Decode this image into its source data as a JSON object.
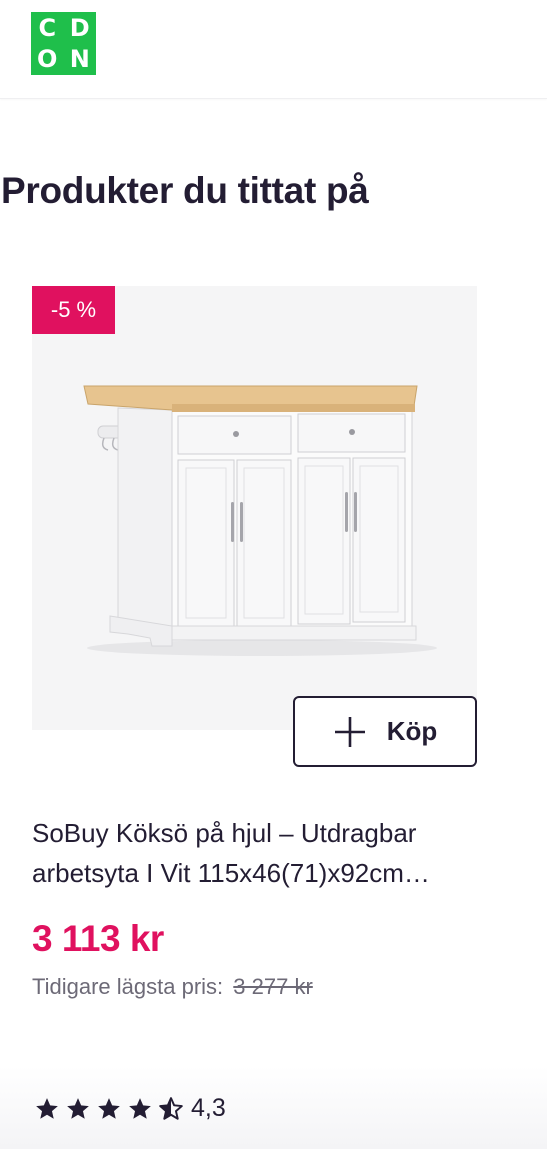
{
  "header": {
    "logo_letters": [
      "C",
      "D",
      "O",
      "N"
    ],
    "logo_color": "#1fbf4b"
  },
  "section": {
    "title": "Produkter du tittat på"
  },
  "product": {
    "discount_badge": "-5 %",
    "buy_label": "Köp",
    "title": "SoBuy Köksö på hjul – Utdragbar arbetsyta I Vit 115x46(71)x92cm…",
    "price": "3 113 kr",
    "previous_price_label": "Tidigare lägsta pris:",
    "previous_price": "3 277 kr",
    "rating_value": "4,3",
    "rating_stars": 4.3,
    "accent_color": "#e0115f"
  }
}
